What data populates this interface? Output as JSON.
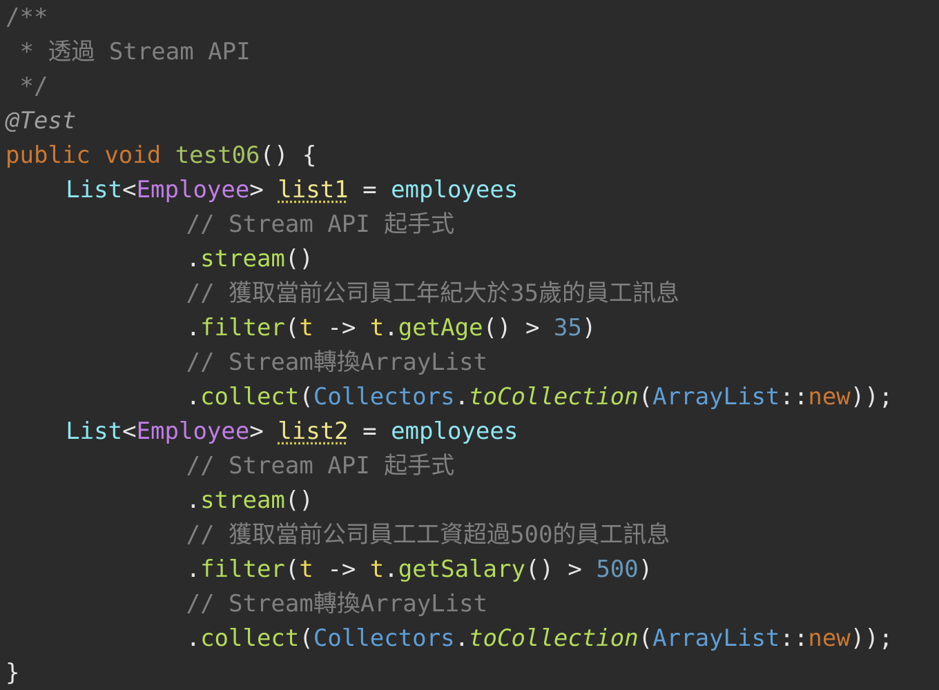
{
  "editor": {
    "language": "java",
    "colors": {
      "background": "#2b2b2b",
      "comment": "#808080",
      "keyword": "#cc7832",
      "type": "#8ee6f0",
      "type_param": "#c17ee8",
      "method": "#b5db5a",
      "number": "#6897bb",
      "class_ref": "#5f9fd7"
    },
    "lines": [
      {
        "indent": 0,
        "tokens": [
          {
            "kind": "comment",
            "text": "/**"
          }
        ]
      },
      {
        "indent": 0,
        "tokens": [
          {
            "kind": "comment",
            "text": " * 透過 Stream API"
          }
        ]
      },
      {
        "indent": 0,
        "tokens": [
          {
            "kind": "comment",
            "text": " */"
          }
        ]
      },
      {
        "indent": 0,
        "tokens": [
          {
            "kind": "annotation",
            "text": "@Test"
          }
        ]
      },
      {
        "indent": 0,
        "tokens": [
          {
            "kind": "keyword",
            "text": "public"
          },
          {
            "kind": "punct",
            "text": " "
          },
          {
            "kind": "keyword",
            "text": "void"
          },
          {
            "kind": "punct",
            "text": " "
          },
          {
            "kind": "method-decl",
            "text": "test06"
          },
          {
            "kind": "punct",
            "text": "() {"
          }
        ]
      },
      {
        "indent": 4,
        "tokens": [
          {
            "kind": "type",
            "text": "List"
          },
          {
            "kind": "punct",
            "text": "<"
          },
          {
            "kind": "type-param",
            "text": "Employee"
          },
          {
            "kind": "punct",
            "text": "> "
          },
          {
            "kind": "local-var",
            "text": "list1"
          },
          {
            "kind": "punct",
            "text": " = "
          },
          {
            "kind": "field",
            "text": "employees"
          }
        ]
      },
      {
        "indent": 12,
        "tokens": [
          {
            "kind": "comment",
            "text": "// Stream API 起手式"
          }
        ]
      },
      {
        "indent": 12,
        "tokens": [
          {
            "kind": "punct",
            "text": "."
          },
          {
            "kind": "method",
            "text": "stream"
          },
          {
            "kind": "punct",
            "text": "()"
          }
        ]
      },
      {
        "indent": 12,
        "tokens": [
          {
            "kind": "comment",
            "text": "// 獲取當前公司員工年紀大於35歲的員工訊息"
          }
        ]
      },
      {
        "indent": 12,
        "tokens": [
          {
            "kind": "punct",
            "text": "."
          },
          {
            "kind": "method",
            "text": "filter"
          },
          {
            "kind": "punct",
            "text": "("
          },
          {
            "kind": "param",
            "text": "t"
          },
          {
            "kind": "punct",
            "text": " -> "
          },
          {
            "kind": "param",
            "text": "t"
          },
          {
            "kind": "punct",
            "text": "."
          },
          {
            "kind": "method",
            "text": "getAge"
          },
          {
            "kind": "punct",
            "text": "() > "
          },
          {
            "kind": "number",
            "text": "35"
          },
          {
            "kind": "punct",
            "text": ")"
          }
        ]
      },
      {
        "indent": 12,
        "tokens": [
          {
            "kind": "comment",
            "text": "// Stream轉換ArrayList"
          }
        ]
      },
      {
        "indent": 12,
        "tokens": [
          {
            "kind": "punct",
            "text": "."
          },
          {
            "kind": "method",
            "text": "collect"
          },
          {
            "kind": "punct",
            "text": "("
          },
          {
            "kind": "class",
            "text": "Collectors"
          },
          {
            "kind": "punct",
            "text": "."
          },
          {
            "kind": "static-method",
            "text": "toCollection"
          },
          {
            "kind": "punct",
            "text": "("
          },
          {
            "kind": "class",
            "text": "ArrayList"
          },
          {
            "kind": "punct",
            "text": "::"
          },
          {
            "kind": "keyword",
            "text": "new"
          },
          {
            "kind": "punct",
            "text": "));"
          }
        ]
      },
      {
        "indent": 4,
        "tokens": [
          {
            "kind": "type",
            "text": "List"
          },
          {
            "kind": "punct",
            "text": "<"
          },
          {
            "kind": "type-param",
            "text": "Employee"
          },
          {
            "kind": "punct",
            "text": "> "
          },
          {
            "kind": "local-var",
            "text": "list2"
          },
          {
            "kind": "punct",
            "text": " = "
          },
          {
            "kind": "field",
            "text": "employees"
          }
        ]
      },
      {
        "indent": 12,
        "tokens": [
          {
            "kind": "comment",
            "text": "// Stream API 起手式"
          }
        ]
      },
      {
        "indent": 12,
        "tokens": [
          {
            "kind": "punct",
            "text": "."
          },
          {
            "kind": "method",
            "text": "stream"
          },
          {
            "kind": "punct",
            "text": "()"
          }
        ]
      },
      {
        "indent": 12,
        "tokens": [
          {
            "kind": "comment",
            "text": "// 獲取當前公司員工工資超過500的員工訊息"
          }
        ]
      },
      {
        "indent": 12,
        "tokens": [
          {
            "kind": "punct",
            "text": "."
          },
          {
            "kind": "method",
            "text": "filter"
          },
          {
            "kind": "punct",
            "text": "("
          },
          {
            "kind": "param",
            "text": "t"
          },
          {
            "kind": "punct",
            "text": " -> "
          },
          {
            "kind": "param",
            "text": "t"
          },
          {
            "kind": "punct",
            "text": "."
          },
          {
            "kind": "method",
            "text": "getSalary"
          },
          {
            "kind": "punct",
            "text": "() > "
          },
          {
            "kind": "number",
            "text": "500"
          },
          {
            "kind": "punct",
            "text": ")"
          }
        ]
      },
      {
        "indent": 12,
        "tokens": [
          {
            "kind": "comment",
            "text": "// Stream轉換ArrayList"
          }
        ]
      },
      {
        "indent": 12,
        "tokens": [
          {
            "kind": "punct",
            "text": "."
          },
          {
            "kind": "method",
            "text": "collect"
          },
          {
            "kind": "punct",
            "text": "("
          },
          {
            "kind": "class",
            "text": "Collectors"
          },
          {
            "kind": "punct",
            "text": "."
          },
          {
            "kind": "static-method",
            "text": "toCollection"
          },
          {
            "kind": "punct",
            "text": "("
          },
          {
            "kind": "class",
            "text": "ArrayList"
          },
          {
            "kind": "punct",
            "text": "::"
          },
          {
            "kind": "keyword",
            "text": "new"
          },
          {
            "kind": "punct",
            "text": "));"
          }
        ]
      },
      {
        "indent": 0,
        "tokens": [
          {
            "kind": "punct",
            "text": "}"
          }
        ]
      }
    ]
  }
}
